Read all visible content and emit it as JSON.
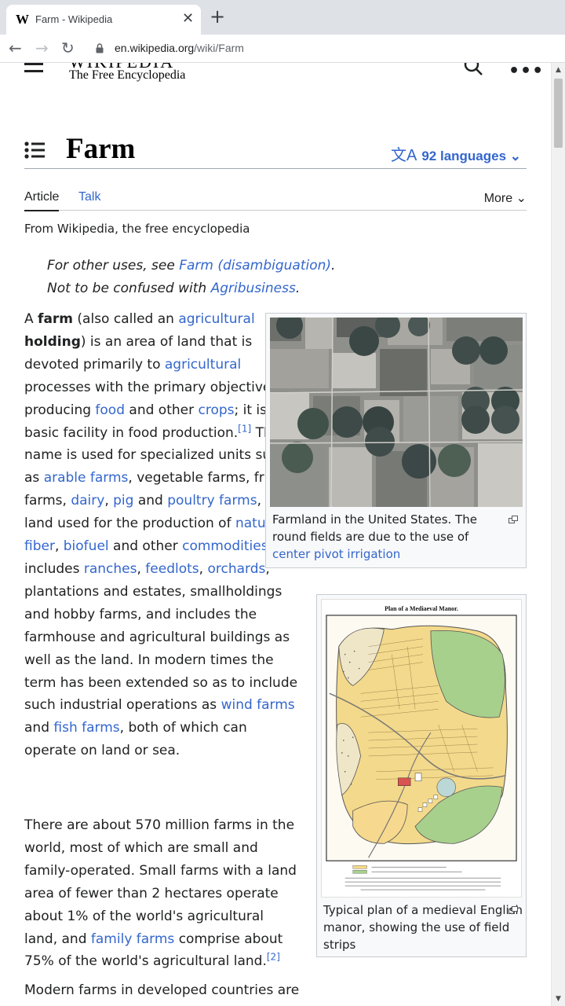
{
  "browser": {
    "tab_favicon": "W",
    "tab_title": "Farm - Wikipedia",
    "tab_close": "✕",
    "new_tab": "+",
    "url_host": "en.wikipedia.org",
    "url_path": "/wiki/Farm",
    "icons": [
      "back-icon",
      "forward-icon",
      "reload-icon",
      "lock-icon"
    ]
  },
  "header": {
    "wordmark_partial": "WIKIPEDIA",
    "tagline": "The Free Encyclopedia",
    "more_glyph": "•••"
  },
  "article": {
    "title": "Farm",
    "languages_glyph": "文A",
    "languages_label": "92 languages",
    "tabs": {
      "article": "Article",
      "talk": "Talk",
      "more": "More"
    },
    "from": "From Wikipedia, the free encyclopedia",
    "hatnotes": {
      "line1_prefix": "For other uses, see ",
      "line1_link": "Farm (disambiguation)",
      "line1_suffix": ".",
      "line2_prefix": "Not to be confused with ",
      "line2_link": "Agribusiness",
      "line2_suffix": "."
    },
    "para1": {
      "t1": "A ",
      "b1": "farm",
      "t2": " (also called an ",
      "l_agricultural1": "agricultural",
      "b2": "holding",
      "t3": ") is an area of land that is devoted primarily to ",
      "l_agricultural2": "agricultural",
      "t4": " processes with the primary objective of producing ",
      "l_food": "food",
      "t5": " and other ",
      "l_crops": "crops",
      "t6": "; it is the basic facility in food production.",
      "ref1": "[1]",
      "t7": " The name is used for specialized units such as ",
      "l_arable": "arable farms",
      "t8": ", vegetable farms, fruit farms, ",
      "l_dairy": "dairy",
      "t9": ", ",
      "l_pig": "pig",
      "t10": " and ",
      "l_poultry": "poultry farms",
      "t11": ", and land used for the production of ",
      "l_natural_fiber": "natural fiber",
      "t12": ", ",
      "l_biofuel": "biofuel",
      "t13": " and other ",
      "l_commodities": "commodities",
      "t14": ". It includes ",
      "l_ranches": "ranches",
      "t15": ", ",
      "l_feedlots": "feedlots",
      "t16": ", ",
      "l_orchards": "orchards",
      "t17": ", plantations and estates, smallholdings and hobby farms, and includes the farmhouse and agricultural buildings as well as the land. In modern times the term has been extended so as to include such industrial operations as ",
      "l_wind": "wind farms",
      "t18": " and ",
      "l_fish": "fish farms",
      "t19": ", both of which can operate on land or sea."
    },
    "para2": {
      "t1": "There are about 570 million farms in the world, most of which are small and family-operated. Small farms with a land area of fewer than 2 hectares operate about 1% of the world's agricultural land, and ",
      "l_family": "family farms",
      "t2": " comprise about 75% of the world's agricultural land.",
      "ref2": "[2]"
    },
    "para3": "Modern farms in developed countries are",
    "figure1": {
      "caption_text": "Farmland in the United States. The round fields are due to the use of ",
      "caption_link": "center pivot irrigation"
    },
    "figure2": {
      "map_title": "Plan of a Mediaeval Manor.",
      "caption": "Typical plan of a medieval English manor, showing the use of field strips"
    }
  },
  "colors": {
    "link": "#3366cc",
    "text": "#202122",
    "chrome": "#dee1e6"
  }
}
